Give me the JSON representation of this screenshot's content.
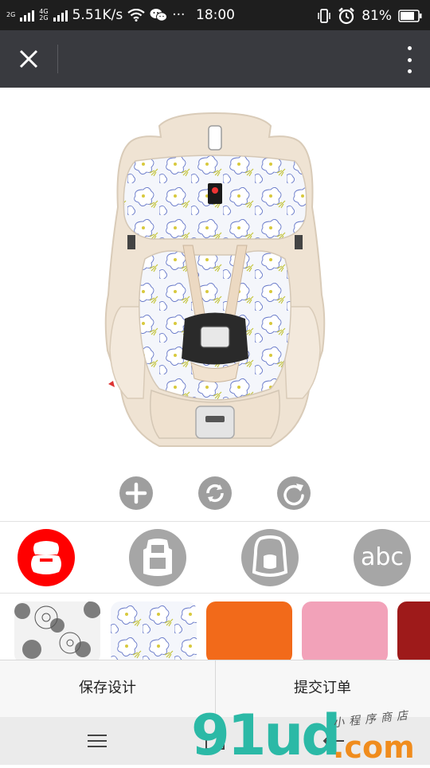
{
  "status_bar": {
    "sim1_label": "2G",
    "sim2_label_top": "4G",
    "sim2_label_bottom": "2G",
    "network_speed": "5.51K/s",
    "overflow": "···",
    "time": "18:00",
    "battery_percent": "81%",
    "battery_level": 0.81
  },
  "top_bar": {
    "close_icon": "close-icon",
    "more_icon": "more-vertical-icon"
  },
  "tools": [
    {
      "name": "add-icon"
    },
    {
      "name": "rotate-icon"
    },
    {
      "name": "redo-icon"
    }
  ],
  "parts": [
    {
      "name": "seat-cushion-part",
      "active": true
    },
    {
      "name": "seat-front-part",
      "active": false
    },
    {
      "name": "seat-back-part",
      "active": false
    },
    {
      "name": "text-part",
      "label": "abc",
      "active": false
    }
  ],
  "swatches": [
    {
      "name": "gray-flower-pattern"
    },
    {
      "name": "blue-yellow-floral-pattern"
    },
    {
      "name": "orange-fabric",
      "color": "#f26a1a"
    },
    {
      "name": "pink-fabric",
      "color": "#f2a2b9"
    },
    {
      "name": "dark-red-fabric",
      "color": "#9e1a1a"
    }
  ],
  "actions": {
    "save_design": "保存设计",
    "submit_order": "提交订单"
  },
  "colors": {
    "accent": "#ff0000",
    "top_bar": "#393a3f",
    "status_bar": "#1e1e1e"
  },
  "watermark": {
    "brand": "91ud",
    "domain": ".com",
    "tagline": "小程序商店"
  }
}
